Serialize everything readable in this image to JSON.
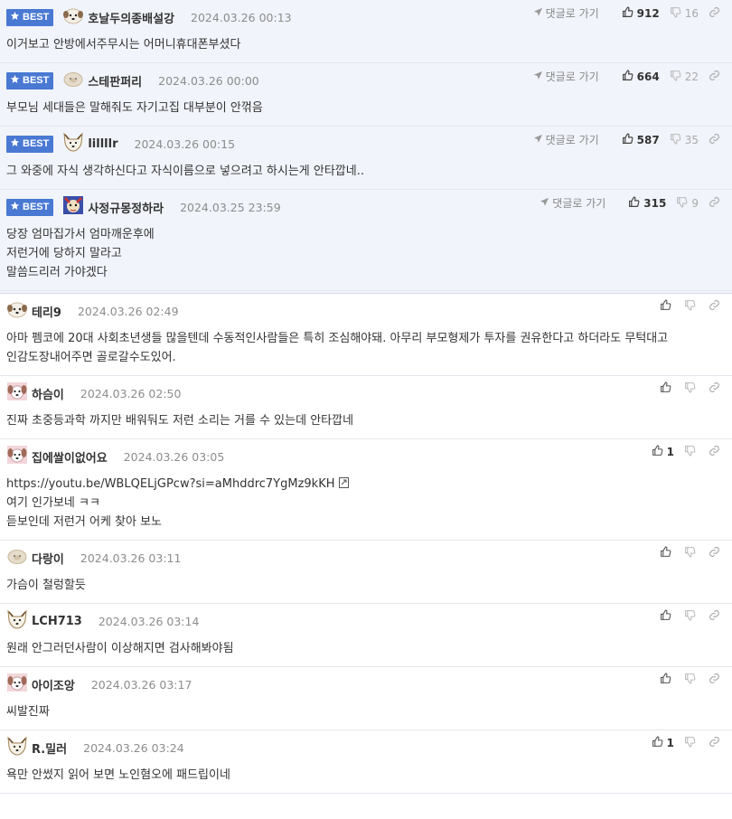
{
  "best_label": "BEST",
  "goto_label": "댓글로 가기",
  "colors": {
    "best_badge": "#4a79d3",
    "best_bg": "#f1f4fb",
    "icon": "#9a9a9a"
  },
  "comments": [
    {
      "best": true,
      "nick": "호날두의종배설강",
      "date": "2024.03.26 00:13",
      "likes": "912",
      "dislikes": "16",
      "avatar": "dog-white-avatar",
      "lines": [
        "이거보고 안방에서주무시는 어머니휴대폰부셨다"
      ]
    },
    {
      "best": true,
      "nick": "스테판퍼리",
      "date": "2024.03.26 00:00",
      "likes": "664",
      "dislikes": "22",
      "avatar": "blob-avatar",
      "lines": [
        "부모님 세대들은 말해줘도 자기고집 대부분이 안꺾음"
      ]
    },
    {
      "best": true,
      "nick": "lillllr",
      "date": "2024.03.26 00:15",
      "likes": "587",
      "dislikes": "35",
      "avatar": "fox-avatar",
      "lines": [
        "그 와중에 자식 생각하신다고 자식이름으로 넣으려고 하시는게 안타깝네.."
      ]
    },
    {
      "best": true,
      "nick": "사정규몽정하라",
      "date": "2024.03.25 23:59",
      "likes": "315",
      "dislikes": "9",
      "avatar": "colorful-avatar",
      "lines": [
        "당장 엄마집가서 엄마깨운후에",
        "저런거에 당하지 말라고",
        "말씀드리러 가야겠다"
      ]
    },
    {
      "best": false,
      "nick": "테리9",
      "date": "2024.03.26 02:49",
      "likes": "",
      "dislikes": "",
      "avatar": "dog-white-avatar",
      "lines": [
        "아마 펨코에 20대 사회초년생들 많을텐데 수동적인사람들은 특히 조심해야돼. 아무리 부모형제가 투자를 권유한다고 하더라도 무턱대고",
        "인감도장내어주면 골로갈수도있어."
      ]
    },
    {
      "best": false,
      "nick": "하슴이",
      "date": "2024.03.26 02:50",
      "likes": "",
      "dislikes": "",
      "avatar": "pink-dog-avatar",
      "lines": [
        "진짜 초중등과학 까지만 배워둬도 저런 소리는 거를 수 있는데 안타깝네"
      ]
    },
    {
      "best": false,
      "nick": "집에쌀이없어요",
      "date": "2024.03.26 03:05",
      "likes": "1",
      "dislikes": "",
      "avatar": "pink-dog-avatar",
      "link": "https://youtu.be/WBLQELjGPcw?si=aMhddrc7YgMz9kKH",
      "lines": [
        "여기 인가보네 ㅋㅋ",
        "듣보인데 저런거 어케 찾아 보노"
      ]
    },
    {
      "best": false,
      "nick": "다랑이",
      "date": "2024.03.26 03:11",
      "likes": "",
      "dislikes": "",
      "avatar": "blob-avatar",
      "lines": [
        "가슴이 철렁할듯"
      ]
    },
    {
      "best": false,
      "nick": "LCH713",
      "date": "2024.03.26 03:14",
      "likes": "",
      "dislikes": "",
      "avatar": "fox-avatar",
      "lines": [
        "원래 안그러던사람이 이상해지면 검사해봐야됨"
      ]
    },
    {
      "best": false,
      "nick": "아이조앙",
      "date": "2024.03.26 03:17",
      "likes": "",
      "dislikes": "",
      "avatar": "pink-dog-avatar",
      "lines": [
        "씨발진짜"
      ]
    },
    {
      "best": false,
      "nick": "R.밀러",
      "date": "2024.03.26 03:24",
      "likes": "1",
      "dislikes": "",
      "avatar": "fox-avatar",
      "lines": [
        "욕만 안썼지 읽어 보면 노인혐오에 패드립이네"
      ]
    }
  ]
}
